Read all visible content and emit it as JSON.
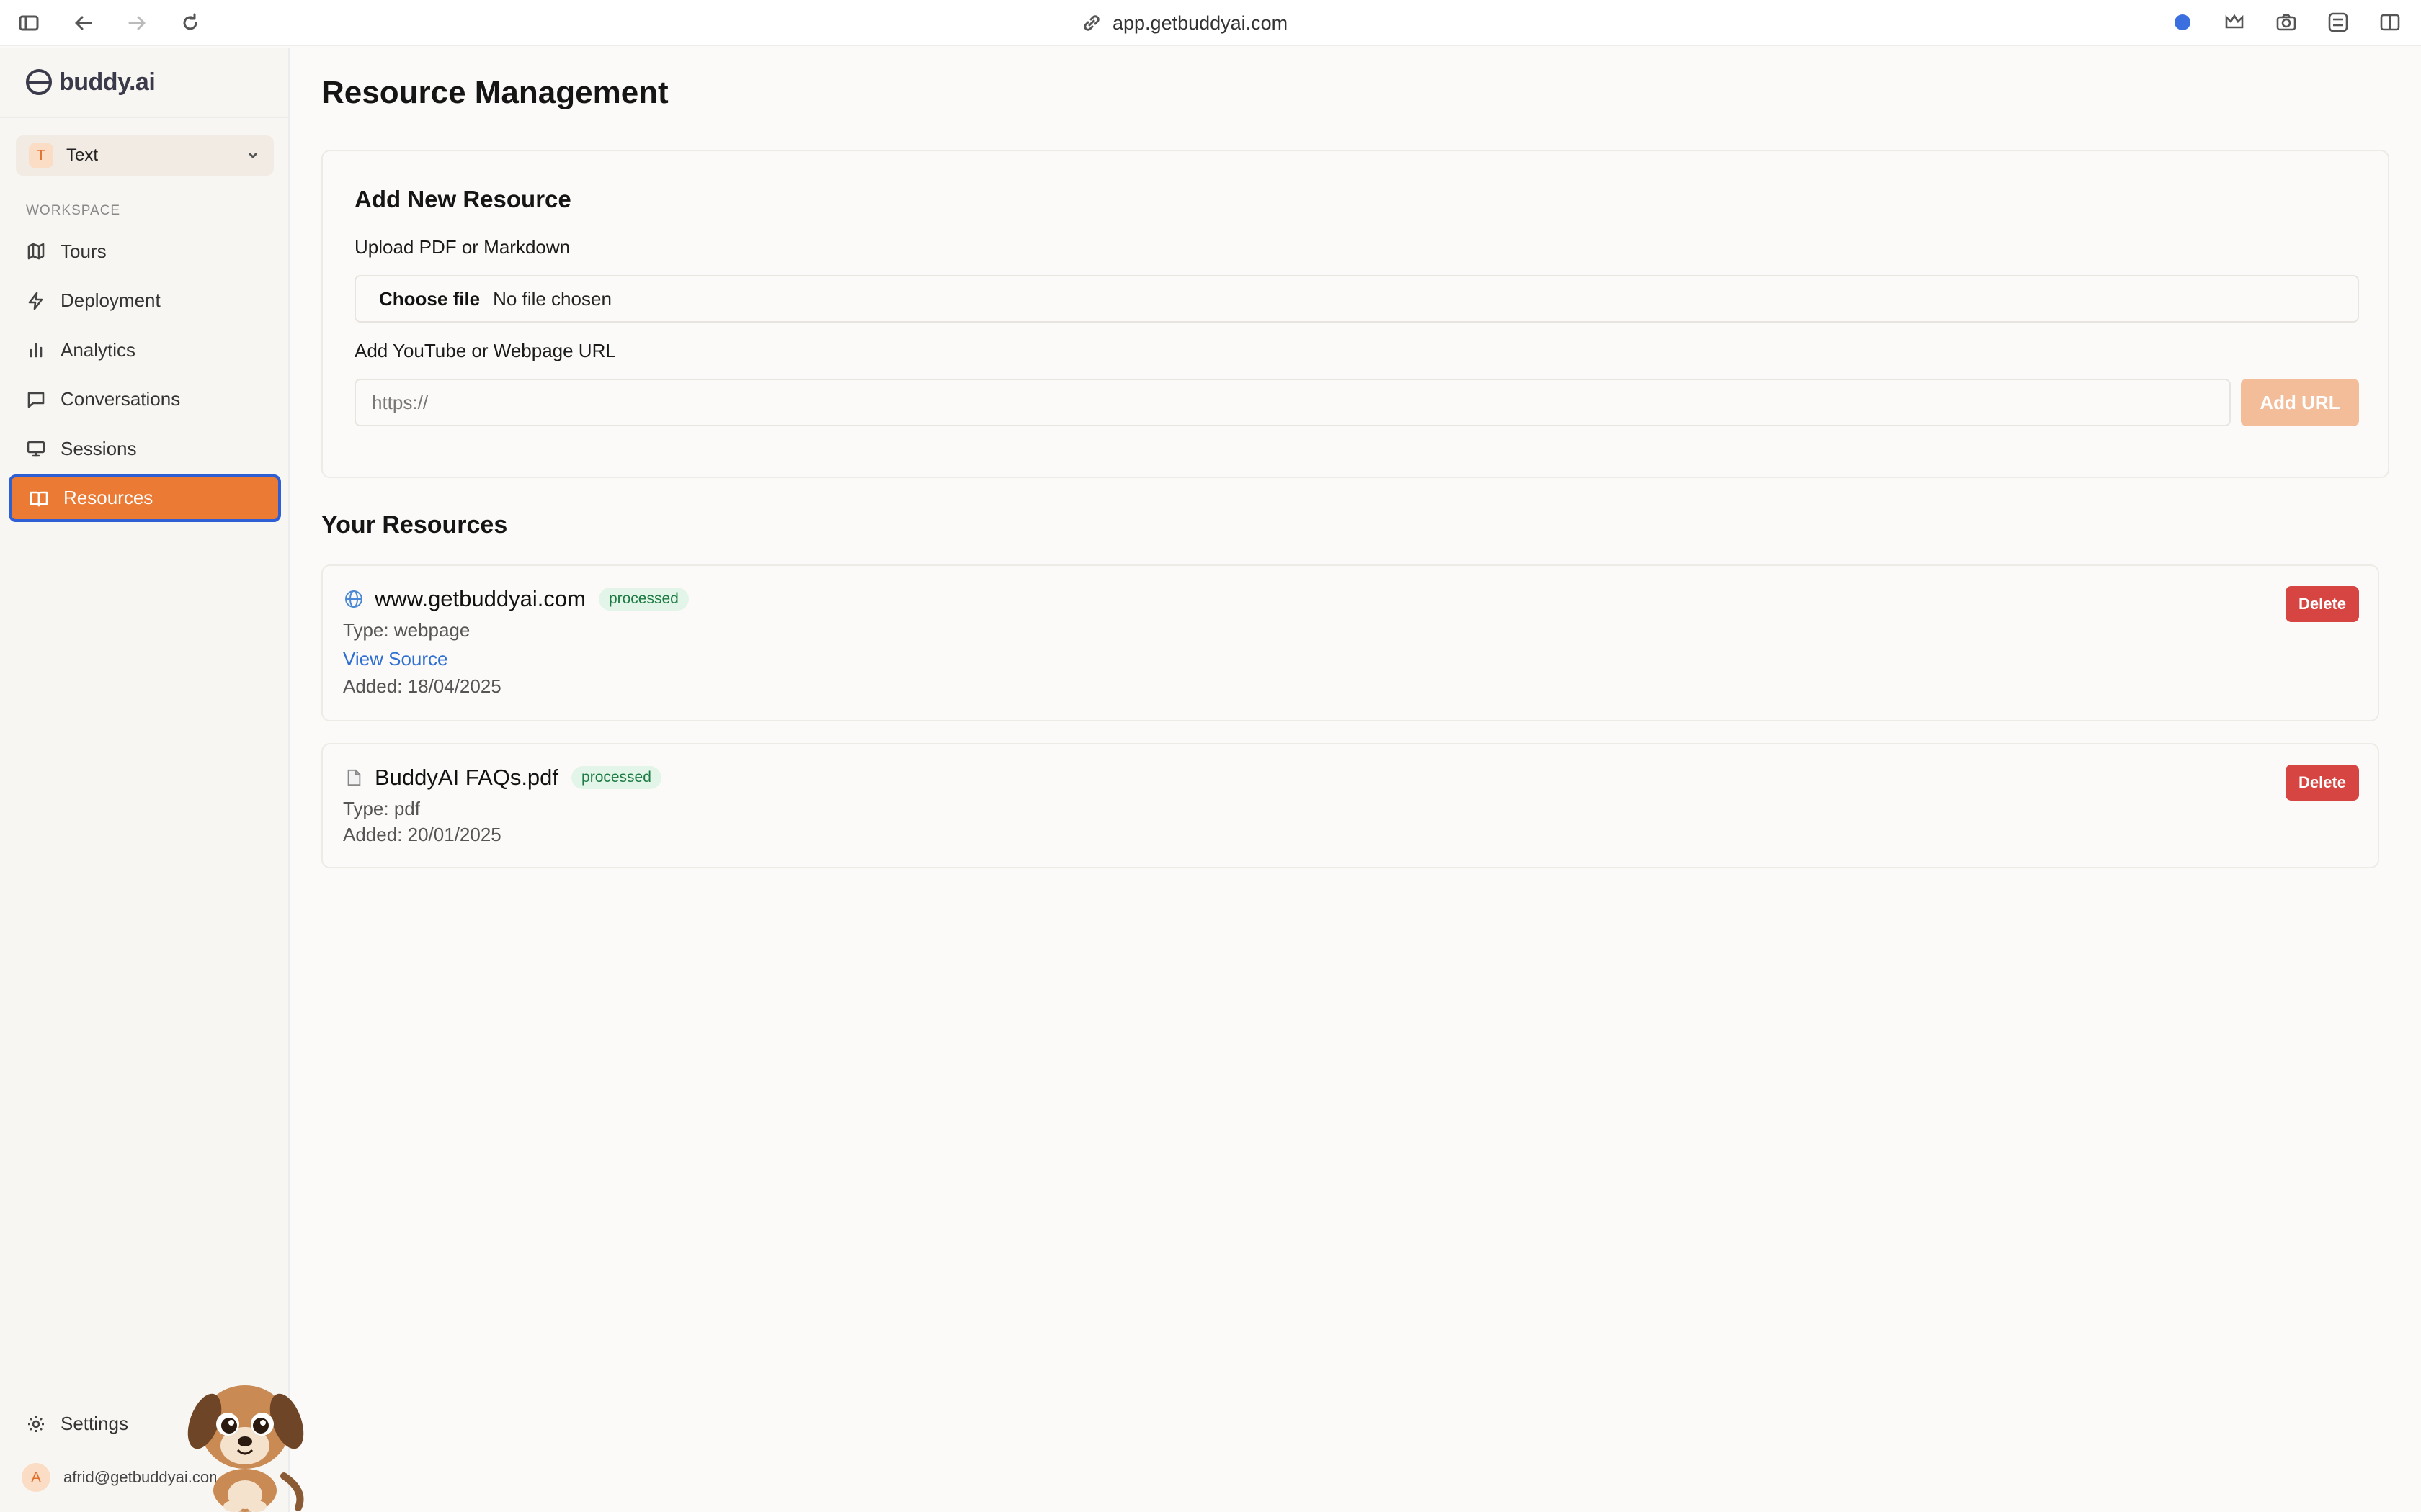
{
  "browser": {
    "url": "app.getbuddyai.com"
  },
  "sidebar": {
    "brand": "buddy.ai",
    "selector": {
      "badge": "T",
      "label": "Text"
    },
    "section_label": "WORKSPACE",
    "items": [
      {
        "label": "Tours",
        "icon": "map-icon"
      },
      {
        "label": "Deployment",
        "icon": "lightning-icon"
      },
      {
        "label": "Analytics",
        "icon": "bar-chart-icon"
      },
      {
        "label": "Conversations",
        "icon": "chat-icon"
      },
      {
        "label": "Sessions",
        "icon": "monitor-icon"
      },
      {
        "label": "Resources",
        "icon": "book-icon",
        "active": true
      }
    ],
    "settings_label": "Settings",
    "user": {
      "initial": "A",
      "email": "afrid@getbuddyai.com"
    }
  },
  "main": {
    "title": "Resource Management",
    "add_card": {
      "title": "Add New Resource",
      "upload_label": "Upload PDF or Markdown",
      "choose_file": "Choose file",
      "no_file": "No file chosen",
      "url_label": "Add YouTube or Webpage URL",
      "url_placeholder": "https://",
      "add_url_button": "Add URL"
    },
    "resources_title": "Your Resources",
    "resources": [
      {
        "icon": "globe-icon",
        "name": "www.getbuddyai.com",
        "status": "processed",
        "type": "Type: webpage",
        "link": "View Source",
        "added": "Added: 18/04/2025",
        "delete": "Delete"
      },
      {
        "icon": "document-icon",
        "name": "BuddyAI FAQs.pdf",
        "status": "processed",
        "type": "Type: pdf",
        "added": "Added: 20/01/2025",
        "delete": "Delete"
      }
    ]
  },
  "colors": {
    "accent": "#ea7a34",
    "active_border": "#2e5fd4",
    "delete": "#d64541",
    "status_text": "#1d7a43",
    "status_bg": "#e2f5e8",
    "link": "#2e6fd4"
  }
}
